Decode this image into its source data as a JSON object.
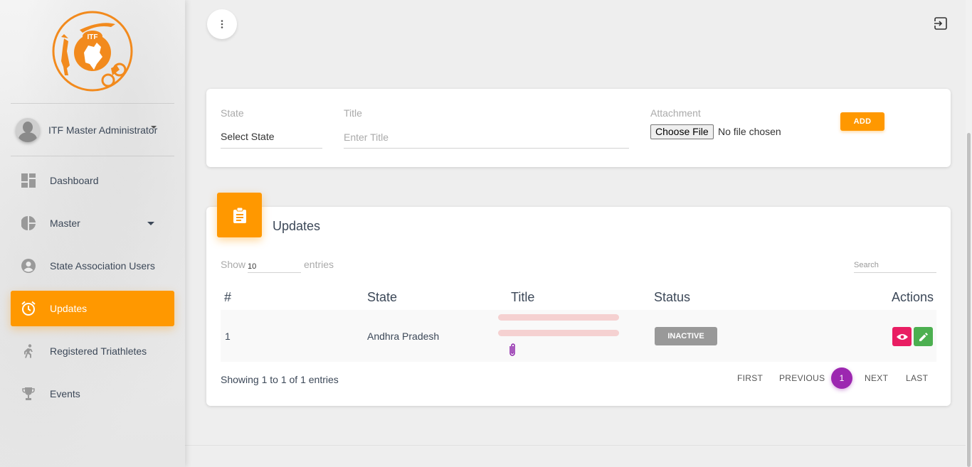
{
  "sidebar": {
    "logo_text": "ITF",
    "user_name": "ITF Master Administrator",
    "items": [
      {
        "label": "Dashboard",
        "icon": "dashboard-icon"
      },
      {
        "label": "Master",
        "icon": "pie-chart-icon"
      },
      {
        "label": "State Association Users",
        "icon": "account-circle-icon"
      },
      {
        "label": "Updates",
        "icon": "alarm-clock-icon",
        "active": true
      },
      {
        "label": "Registered Triathletes",
        "icon": "runner-icon"
      },
      {
        "label": "Events",
        "icon": "trophy-icon"
      }
    ]
  },
  "form": {
    "state_label": "State",
    "state_value": "Select State",
    "title_label": "Title",
    "title_placeholder": "Enter Title",
    "attachment_label": "Attachment",
    "choose_file": "Choose File",
    "no_file": "No file chosen",
    "add": "ADD"
  },
  "list": {
    "title": "Updates",
    "show": "Show",
    "entries_value": "10",
    "entries": "entries",
    "search_placeholder": "Search",
    "columns": [
      "#",
      "State",
      "Title",
      "Status",
      "Actions"
    ],
    "rows": [
      {
        "num": "1",
        "state": "Andhra Pradesh",
        "status": "INACTIVE"
      }
    ],
    "showing": "Showing 1 to 1 of 1 entries",
    "pager": {
      "first": "FIRST",
      "previous": "PREVIOUS",
      "current": "1",
      "next": "NEXT",
      "last": "LAST"
    }
  },
  "colors": {
    "accent": "#ff9800",
    "pager_active": "#9c27b0",
    "view": "#e91e63",
    "edit": "#4caf50",
    "badge": "#999999"
  }
}
